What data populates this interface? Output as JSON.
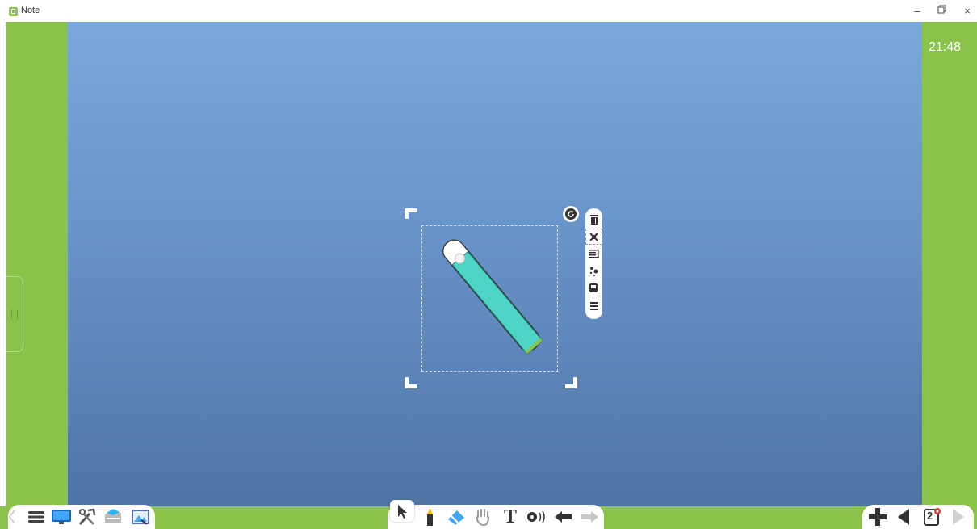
{
  "window": {
    "title": "Note",
    "minimize_label": "–",
    "maximize_label": "□",
    "close_label": "×"
  },
  "clock": "21:48",
  "page_badge": "2",
  "colors": {
    "panel_green": "#8bc34a",
    "canvas_top": "#79a9dc",
    "canvas_bottom": "#4f74a6",
    "object_fill": "#4dd4c4"
  },
  "left_tray": {
    "icons": [
      "chevron-left-icon",
      "menu-icon",
      "monitor-icon",
      "tools-icon",
      "folder-icon",
      "image-icon"
    ]
  },
  "center_tray": {
    "icons": [
      "select-cursor-icon",
      "pen-icon",
      "eraser-icon",
      "hand-icon",
      "text-icon",
      "sound-icon",
      "undo-icon",
      "redo-icon"
    ],
    "text_label": "T"
  },
  "right_tray": {
    "icons": [
      "add-page-icon",
      "previous-page-icon",
      "page-list-icon",
      "next-page-icon"
    ]
  },
  "object_toolbar": {
    "icons": [
      "delete-icon",
      "lock-icon",
      "align-icon",
      "effects-icon",
      "layer-icon",
      "more-menu-icon"
    ]
  },
  "selected_object": {
    "name": "test-tube",
    "fill_level": 0.85
  }
}
